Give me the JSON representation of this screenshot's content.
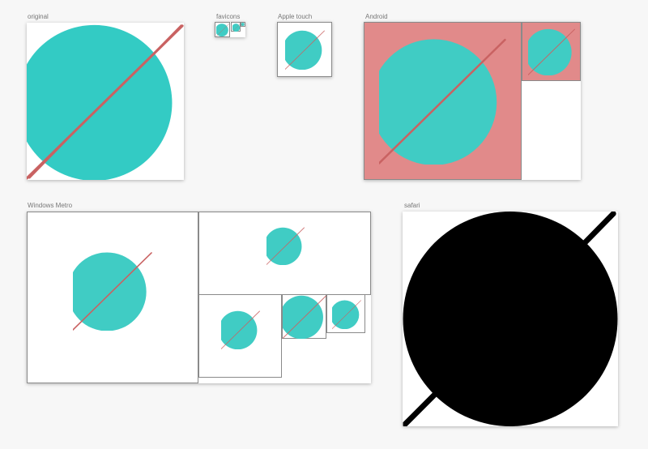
{
  "sections": {
    "original": {
      "label": "original"
    },
    "favicons": {
      "label": "favicons"
    },
    "apple_touch": {
      "label": "Apple touch"
    },
    "android": {
      "label": "Android"
    },
    "windows_metro": {
      "label": "Windows Metro"
    },
    "safari": {
      "label": "safari"
    }
  },
  "colors": {
    "page_background": "#f7f7f7",
    "planet": "#33cbc4",
    "planet_light": "#40ccc4",
    "ring": "#c96262",
    "android_background": "#e18a8a",
    "safari_mask": "#000000",
    "tile_background": "#ffffff",
    "tile_border": "#8a8a8a"
  },
  "icons": {
    "planet": "planet-with-ring-icon",
    "safari_pinned_tab": "monochrome-planet-mask-icon"
  }
}
